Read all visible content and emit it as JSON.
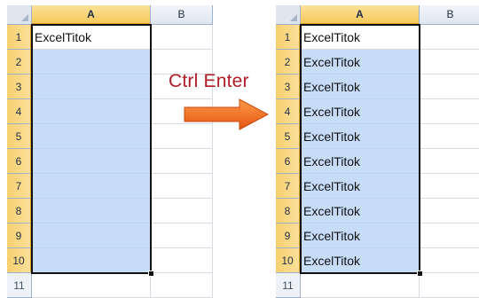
{
  "shortcut": {
    "label": "Ctrl Enter"
  },
  "colors": {
    "arrow": "#f26f1f",
    "label": "#b01c25",
    "selection_fill": "#c6dcf7",
    "header_highlight": "#f6c95b"
  },
  "left_sheet": {
    "columns": [
      "A",
      "B"
    ],
    "rows": [
      "1",
      "2",
      "3",
      "4",
      "5",
      "6",
      "7",
      "8",
      "9",
      "10",
      "11"
    ],
    "cells_a": [
      "ExcelTitok",
      "",
      "",
      "",
      "",
      "",
      "",
      "",
      "",
      "",
      ""
    ]
  },
  "right_sheet": {
    "columns": [
      "A",
      "B"
    ],
    "rows": [
      "1",
      "2",
      "3",
      "4",
      "5",
      "6",
      "7",
      "8",
      "9",
      "10",
      "11"
    ],
    "cells_a": [
      "ExcelTitok",
      "ExcelTitok",
      "ExcelTitok",
      "ExcelTitok",
      "ExcelTitok",
      "ExcelTitok",
      "ExcelTitok",
      "ExcelTitok",
      "ExcelTitok",
      "ExcelTitok",
      ""
    ]
  }
}
